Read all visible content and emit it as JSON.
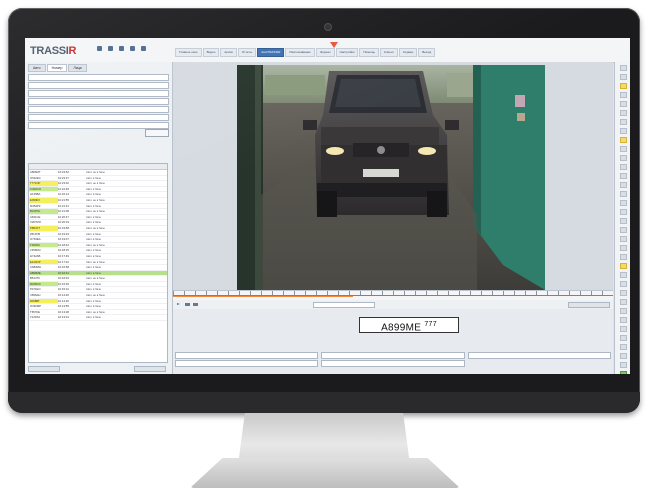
{
  "app": {
    "logo_main": "TRASSI",
    "logo_r": "R"
  },
  "tabs": [
    "Главное окно",
    "Видео",
    "Архив",
    "Отчёты",
    "AutoTRASSIR",
    "Распознавание",
    "Журнал",
    "Настройки",
    "Помощь",
    "Клиент",
    "Сервер",
    "Выход"
  ],
  "left_panel": {
    "tabs": [
      "Авто",
      "Номер",
      "Лица"
    ]
  },
  "events": [
    {
      "plate": "А806МТ",
      "time": "10:23:52",
      "state": "Авто не в базе",
      "mark": "none"
    },
    {
      "plate": "О532ЕС",
      "time": "10:23:37",
      "state": "Авто в базе",
      "mark": "none"
    },
    {
      "plate": "Т771ОР",
      "time": "10:23:02",
      "state": "Авто не в базе",
      "mark": "yellow"
    },
    {
      "plate": "С400ОО",
      "time": "10:22:48",
      "state": "Авто в базе",
      "mark": "green"
    },
    {
      "plate": "Н125ВА",
      "time": "10:22:14",
      "state": "Авто в базе",
      "mark": "none"
    },
    {
      "plate": "Е099КХ",
      "time": "10:21:55",
      "state": "Авто не в базе",
      "mark": "yellow"
    },
    {
      "plate": "М452РК",
      "time": "10:21:31",
      "state": "Авто в базе",
      "mark": "none"
    },
    {
      "plate": "В318ТН",
      "time": "10:21:08",
      "state": "Авто не в базе",
      "mark": "green"
    },
    {
      "plate": "А631СЕ",
      "time": "10:20:47",
      "state": "Авто в базе",
      "mark": "none"
    },
    {
      "plate": "Х207МО",
      "time": "10:20:19",
      "state": "Авто в базе",
      "mark": "none"
    },
    {
      "plate": "Р884ХТ",
      "time": "10:19:58",
      "state": "Авто не в базе",
      "mark": "yellow"
    },
    {
      "plate": "К510УВ",
      "time": "10:19:33",
      "state": "Авто в базе",
      "mark": "none"
    },
    {
      "plate": "О763ЕА",
      "time": "10:19:07",
      "state": "Авто в базе",
      "mark": "none"
    },
    {
      "plate": "Т090ХС",
      "time": "10:18:42",
      "state": "Авто не в базе",
      "mark": "green"
    },
    {
      "plate": "У356КМ",
      "time": "10:18:15",
      "state": "Авто в базе",
      "mark": "none"
    },
    {
      "plate": "Н742АВ",
      "time": "10:17:49",
      "state": "Авто в базе",
      "mark": "none"
    },
    {
      "plate": "Е129ОР",
      "time": "10:17:22",
      "state": "Авто не в базе",
      "mark": "yellow"
    },
    {
      "plate": "С683МН",
      "time": "10:16:58",
      "state": "Авто в базе",
      "mark": "none"
    },
    {
      "plate": "А899МЕ",
      "time": "10:16:31",
      "state": "Авто в базе",
      "mark": "selected"
    },
    {
      "plate": "В514ТК",
      "time": "10:16:04",
      "state": "Авто не в базе",
      "mark": "none"
    },
    {
      "plate": "М205СХ",
      "time": "10:15:39",
      "state": "Авто в базе",
      "mark": "green"
    },
    {
      "plate": "Р471ЕО",
      "time": "10:15:12",
      "state": "Авто в базе",
      "mark": "none"
    },
    {
      "plate": "Х836АН",
      "time": "10:14:46",
      "state": "Авто не в базе",
      "mark": "none"
    },
    {
      "plate": "К068ВТ",
      "time": "10:14:20",
      "state": "Авто в базе",
      "mark": "yellow"
    },
    {
      "plate": "О392МР",
      "time": "10:13:55",
      "state": "Авто в базе",
      "mark": "none"
    },
    {
      "plate": "Т657КЕ",
      "time": "10:13:28",
      "state": "Авто не в базе",
      "mark": "none"
    },
    {
      "plate": "У120ХА",
      "time": "10:13:01",
      "state": "Авто в базе",
      "mark": "none"
    }
  ],
  "plate": {
    "number": "А899МЕ",
    "region": "777"
  },
  "colors": {
    "accent": "#3d70b2",
    "marker": "#e8553e",
    "plate_highlight_yellow": "#f6ef5a",
    "plate_highlight_green": "#c4ea8a"
  }
}
